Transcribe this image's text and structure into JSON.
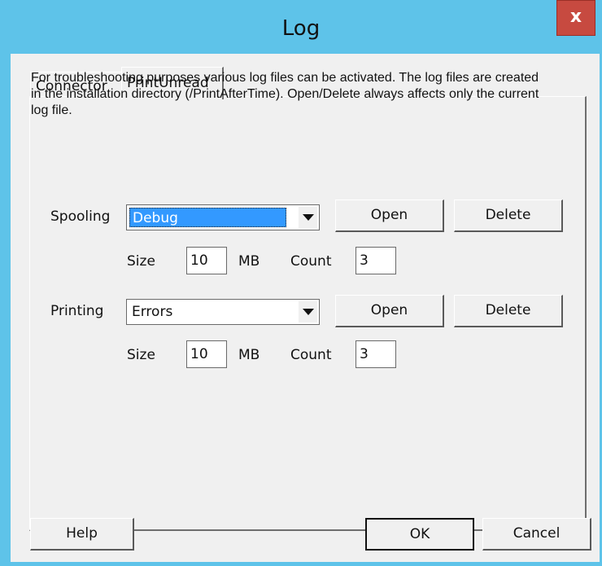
{
  "window": {
    "title": "Log",
    "close_glyph": "x"
  },
  "tabs": [
    {
      "label": "Connector",
      "active": false
    },
    {
      "label": "PrintUnread",
      "active": true
    }
  ],
  "description": "For troubleshooting purposes various log files can be activated. The log files are created in the installation directory (/PrintAfterTime). Open/Delete always affects only the current log file.",
  "spooling": {
    "label": "Spooling",
    "level": "Debug",
    "open_label": "Open",
    "delete_label": "Delete",
    "size_label": "Size",
    "size_value": "10",
    "unit": "MB",
    "count_label": "Count",
    "count_value": "3"
  },
  "printing": {
    "label": "Printing",
    "level": "Errors",
    "open_label": "Open",
    "delete_label": "Delete",
    "size_label": "Size",
    "size_value": "10",
    "unit": "MB",
    "count_label": "Count",
    "count_value": "3"
  },
  "footer": {
    "help_label": "Help",
    "ok_label": "OK",
    "cancel_label": "Cancel"
  },
  "icons": {
    "dropdown": "chevron-down-icon",
    "close": "close-icon"
  },
  "colors": {
    "titlebar": "#5ec3e9",
    "close": "#c74a40",
    "selection": "#3399ff",
    "dialog": "#f0f0f0"
  }
}
